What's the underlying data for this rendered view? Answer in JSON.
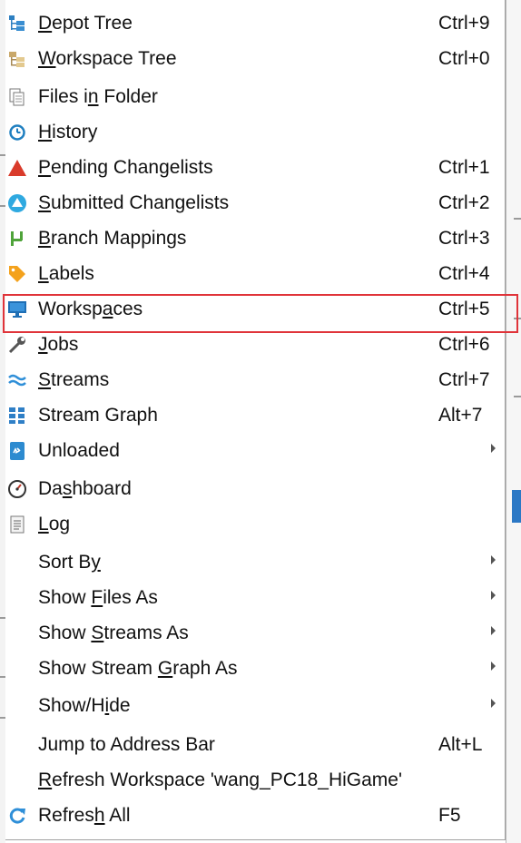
{
  "menu": {
    "items": [
      {
        "pre": "",
        "u": "D",
        "post": "epot Tree",
        "shortcut": "Ctrl+9",
        "icon": "depot-tree-icon",
        "submenu": false
      },
      {
        "pre": "",
        "u": "W",
        "post": "orkspace Tree",
        "shortcut": "Ctrl+0",
        "icon": "workspace-tree-icon",
        "submenu": false
      },
      {
        "pre": "Files i",
        "u": "n",
        "post": " Folder",
        "shortcut": "",
        "icon": "files-in-folder-icon",
        "submenu": false
      },
      {
        "pre": "",
        "u": "H",
        "post": "istory",
        "shortcut": "",
        "icon": "history-icon",
        "submenu": false
      },
      {
        "pre": "",
        "u": "P",
        "post": "ending Changelists",
        "shortcut": "Ctrl+1",
        "icon": "pending-changelists-icon",
        "submenu": false
      },
      {
        "pre": "",
        "u": "S",
        "post": "ubmitted Changelists",
        "shortcut": "Ctrl+2",
        "icon": "submitted-changelists-icon",
        "submenu": false
      },
      {
        "pre": "",
        "u": "B",
        "post": "ranch Mappings",
        "shortcut": "Ctrl+3",
        "icon": "branch-mappings-icon",
        "submenu": false
      },
      {
        "pre": "",
        "u": "L",
        "post": "abels",
        "shortcut": "Ctrl+4",
        "icon": "labels-icon",
        "submenu": false
      },
      {
        "pre": "Worksp",
        "u": "a",
        "post": "ces",
        "shortcut": "Ctrl+5",
        "icon": "workspaces-icon",
        "submenu": false
      },
      {
        "pre": "",
        "u": "J",
        "post": "obs",
        "shortcut": "Ctrl+6",
        "icon": "jobs-icon",
        "submenu": false
      },
      {
        "pre": "",
        "u": "S",
        "post": "treams",
        "shortcut": "Ctrl+7",
        "icon": "streams-icon",
        "submenu": false
      },
      {
        "pre": "Stream Graph",
        "u": "",
        "post": "",
        "shortcut": "Alt+7",
        "icon": "stream-graph-icon",
        "submenu": false
      },
      {
        "pre": "Unloaded",
        "u": "",
        "post": "",
        "shortcut": "",
        "icon": "unloaded-icon",
        "submenu": true
      },
      {
        "pre": "Da",
        "u": "s",
        "post": "hboard",
        "shortcut": "",
        "icon": "dashboard-icon",
        "submenu": false
      },
      {
        "pre": "",
        "u": "L",
        "post": "og",
        "shortcut": "",
        "icon": "log-icon",
        "submenu": false
      },
      {
        "pre": "Sort B",
        "u": "y",
        "post": "",
        "shortcut": "",
        "icon": "",
        "submenu": true
      },
      {
        "pre": "Show ",
        "u": "F",
        "post": "iles As",
        "shortcut": "",
        "icon": "",
        "submenu": true
      },
      {
        "pre": "Show ",
        "u": "S",
        "post": "treams As",
        "shortcut": "",
        "icon": "",
        "submenu": true
      },
      {
        "pre": "Show Stream ",
        "u": "G",
        "post": "raph As",
        "shortcut": "",
        "icon": "",
        "submenu": true
      },
      {
        "pre": "Show/H",
        "u": "i",
        "post": "de",
        "shortcut": "",
        "icon": "",
        "submenu": true
      },
      {
        "pre": "Jump to Address Bar",
        "u": "",
        "post": "",
        "shortcut": "Alt+L",
        "icon": "",
        "submenu": false
      },
      {
        "pre": "",
        "u": "R",
        "post": "efresh Workspace 'wang_PC18_HiGame'",
        "shortcut": "",
        "icon": "",
        "submenu": false
      },
      {
        "pre": "Refres",
        "u": "h",
        "post": " All",
        "shortcut": "F5",
        "icon": "refresh-all-icon",
        "submenu": false
      }
    ]
  },
  "highlighted_item": "Workspaces",
  "colors": {
    "highlight_border": "#e0343a",
    "pending_red": "#d93b2b",
    "submitted_blue": "#2fa9e0",
    "branch_green": "#4fa33a",
    "label_orange": "#f4a21c",
    "workspace_blue": "#1f6fb5"
  }
}
